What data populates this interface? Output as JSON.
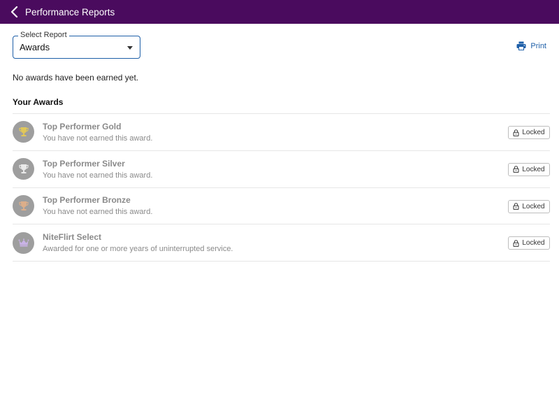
{
  "header": {
    "title": "Performance Reports"
  },
  "report_select": {
    "label": "Select Report",
    "value": "Awards"
  },
  "print": {
    "label": "Print"
  },
  "status_message": "No awards have been earned yet.",
  "awards_section": {
    "title": "Your Awards",
    "items": [
      {
        "title": "Top Performer Gold",
        "description": "You have not earned this award.",
        "status": "Locked",
        "icon": "gold-trophy-icon",
        "icon_color": "#e0c75a"
      },
      {
        "title": "Top Performer Silver",
        "description": "You have not earned this award.",
        "status": "Locked",
        "icon": "silver-trophy-icon",
        "icon_color": "#e9e9e9"
      },
      {
        "title": "Top Performer Bronze",
        "description": "You have not earned this award.",
        "status": "Locked",
        "icon": "bronze-trophy-icon",
        "icon_color": "#dcae8a"
      },
      {
        "title": "NiteFlirt Select",
        "description": "Awarded for one or more years of uninterrupted service.",
        "status": "Locked",
        "icon": "crown-icon",
        "icon_color": "#c9b3e6"
      }
    ]
  },
  "colors": {
    "header_bg": "#4a0b5e",
    "accent": "#1e5fa8",
    "muted_text": "#8a8a8a"
  }
}
